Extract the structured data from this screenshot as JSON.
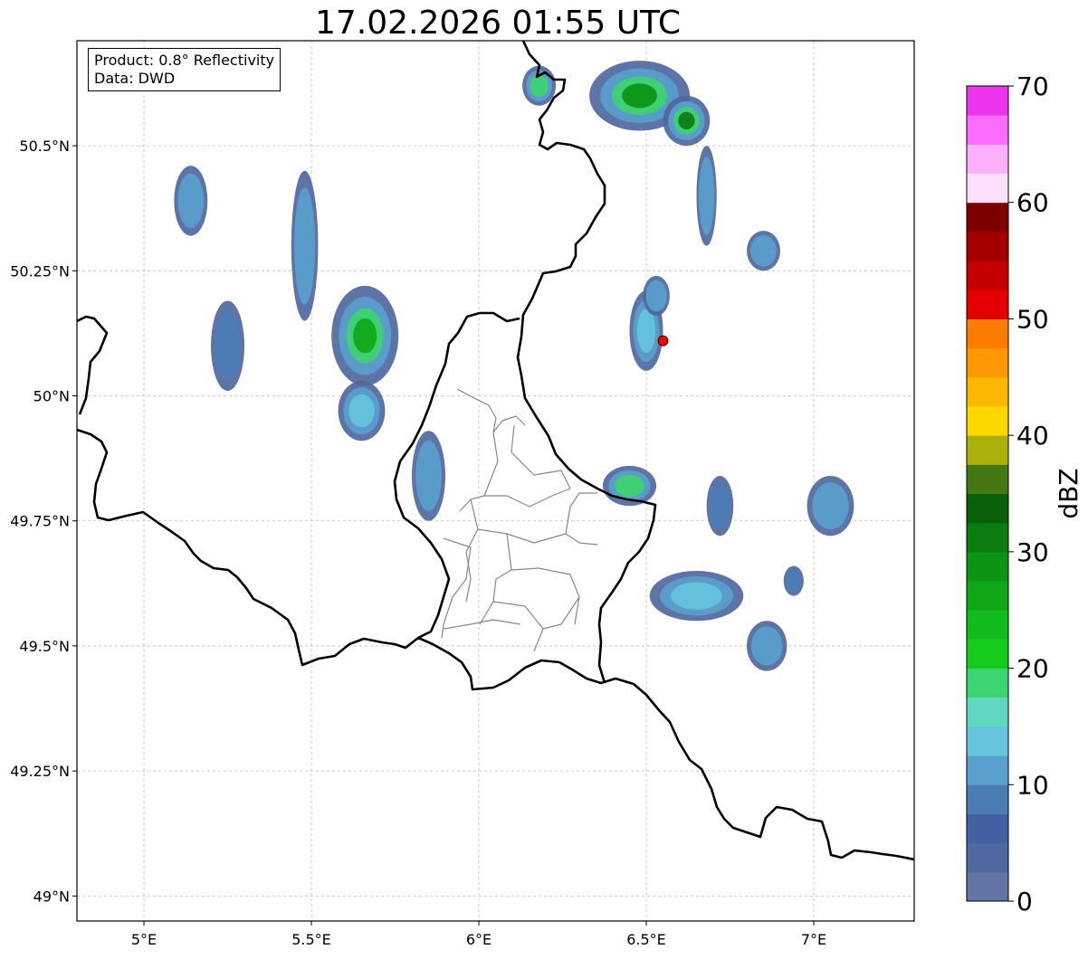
{
  "title": "17.02.2026 01:55 UTC",
  "info": {
    "product": "Product: 0.8° Reflectivity",
    "data": "Data: DWD"
  },
  "axes": {
    "lon_range": [
      4.8,
      7.3
    ],
    "lat_range": [
      48.95,
      50.71
    ],
    "x_ticks": [
      {
        "value": 5.0,
        "label": "5°E"
      },
      {
        "value": 5.5,
        "label": "5.5°E"
      },
      {
        "value": 6.0,
        "label": "6°E"
      },
      {
        "value": 6.5,
        "label": "6.5°E"
      },
      {
        "value": 7.0,
        "label": "7°E"
      }
    ],
    "y_ticks": [
      {
        "value": 49.0,
        "label": "49°N"
      },
      {
        "value": 49.25,
        "label": "49.25°N"
      },
      {
        "value": 49.5,
        "label": "49.5°N"
      },
      {
        "value": 49.75,
        "label": "49.75°N"
      },
      {
        "value": 50.0,
        "label": "50°N"
      },
      {
        "value": 50.25,
        "label": "50.25°N"
      },
      {
        "value": 50.5,
        "label": "50.5°N"
      }
    ],
    "grid": true
  },
  "radar_site": {
    "lon": 6.55,
    "lat": 50.11,
    "color": "#ff0000"
  },
  "colorbar": {
    "label": "dBZ",
    "min": 0,
    "max": 70,
    "tick_values": [
      0,
      10,
      20,
      30,
      40,
      50,
      60,
      70
    ],
    "tick_labels": [
      "0",
      "10",
      "20",
      "30",
      "40",
      "50",
      "60",
      "70"
    ],
    "colors": [
      "#6474a4",
      "#5068a0",
      "#4460a4",
      "#4c7cb4",
      "#5aa0cc",
      "#66c4dc",
      "#60d8c0",
      "#3cd470",
      "#14cc1c",
      "#10bc1c",
      "#10a818",
      "#0c9414",
      "#0c7c10",
      "#086008",
      "#447814",
      "#acb00c",
      "#fcd800",
      "#fcb800",
      "#fc9800",
      "#fc7c00",
      "#e40000",
      "#c40000",
      "#a40000",
      "#7c0000",
      "#fce0fc",
      "#fcb0fc",
      "#fc6cfc",
      "#ec34ec"
    ]
  },
  "echoes": [
    {
      "lon": 6.48,
      "lat": 50.6,
      "rx": 0.15,
      "ry": 0.07,
      "dbz": 28
    },
    {
      "lon": 6.62,
      "lat": 50.55,
      "rx": 0.07,
      "ry": 0.05,
      "dbz": 32
    },
    {
      "lon": 6.18,
      "lat": 50.62,
      "rx": 0.05,
      "ry": 0.04,
      "dbz": 18
    },
    {
      "lon": 5.66,
      "lat": 50.12,
      "rx": 0.1,
      "ry": 0.1,
      "dbz": 26
    },
    {
      "lon": 5.48,
      "lat": 50.3,
      "rx": 0.04,
      "ry": 0.15,
      "dbz": 12
    },
    {
      "lon": 5.14,
      "lat": 50.39,
      "rx": 0.05,
      "ry": 0.07,
      "dbz": 12
    },
    {
      "lon": 5.25,
      "lat": 50.1,
      "rx": 0.05,
      "ry": 0.09,
      "dbz": 8
    },
    {
      "lon": 5.65,
      "lat": 49.97,
      "rx": 0.07,
      "ry": 0.06,
      "dbz": 14
    },
    {
      "lon": 5.85,
      "lat": 49.84,
      "rx": 0.05,
      "ry": 0.09,
      "dbz": 12
    },
    {
      "lon": 6.45,
      "lat": 49.82,
      "rx": 0.08,
      "ry": 0.04,
      "dbz": 18
    },
    {
      "lon": 6.65,
      "lat": 49.6,
      "rx": 0.14,
      "ry": 0.05,
      "dbz": 14
    },
    {
      "lon": 6.86,
      "lat": 49.5,
      "rx": 0.06,
      "ry": 0.05,
      "dbz": 10
    },
    {
      "lon": 7.05,
      "lat": 49.78,
      "rx": 0.07,
      "ry": 0.06,
      "dbz": 10
    },
    {
      "lon": 6.5,
      "lat": 50.13,
      "rx": 0.05,
      "ry": 0.08,
      "dbz": 14
    },
    {
      "lon": 6.68,
      "lat": 50.4,
      "rx": 0.03,
      "ry": 0.1,
      "dbz": 10
    },
    {
      "lon": 6.85,
      "lat": 50.29,
      "rx": 0.05,
      "ry": 0.04,
      "dbz": 10
    },
    {
      "lon": 6.53,
      "lat": 50.2,
      "rx": 0.04,
      "ry": 0.04,
      "dbz": 12
    },
    {
      "lon": 6.72,
      "lat": 49.78,
      "rx": 0.04,
      "ry": 0.06,
      "dbz": 8
    },
    {
      "lon": 6.94,
      "lat": 49.63,
      "rx": 0.03,
      "ry": 0.03,
      "dbz": 8
    }
  ]
}
